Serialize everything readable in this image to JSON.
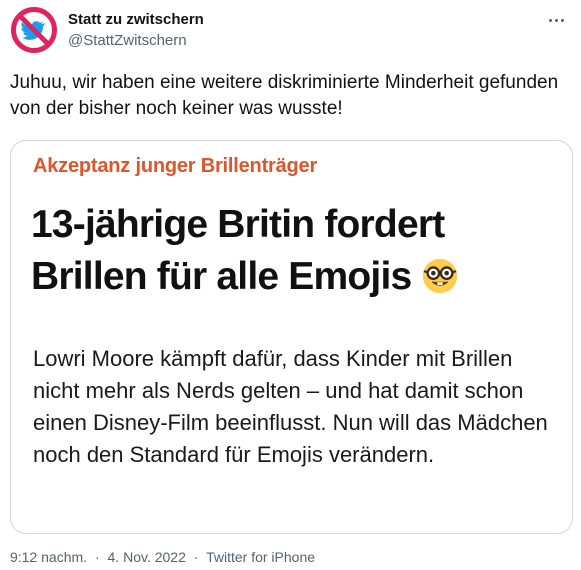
{
  "author": {
    "display_name": "Statt zu zwitschern",
    "handle": "@StattZwitschern",
    "avatar_icon": "no-twitter-bird-icon"
  },
  "menu": {
    "icon": "more-icon"
  },
  "tweet": {
    "text": "Juhuu, wir haben eine weitere diskriminierte Minderheit gefunden von der bisher noch keiner was wusste!"
  },
  "card": {
    "kicker": "Akzeptanz junger Brillenträger",
    "headline_line1": "13-jährige Britin fordert",
    "headline_line2": "Brillen für alle Emojis",
    "emoji_icon": "nerd-face-emoji-icon",
    "teaser": "Lowri Moore kämpft dafür, dass Kinder mit Brillen nicht mehr als Nerds gelten – und hat damit schon einen Disney-Film beeinflusst. Nun will das Mädchen noch den Standard für Emojis verändern."
  },
  "meta": {
    "time": "9:12 nachm.",
    "separator": "·",
    "date": "4. Nov. 2022",
    "source": "Twitter for iPhone"
  },
  "colors": {
    "kicker": "#e2542a",
    "brand_blue": "#1d9bf0",
    "forbidden_red": "#e0245e",
    "secondary_text": "#536471",
    "card_border": "#cfd9de"
  }
}
